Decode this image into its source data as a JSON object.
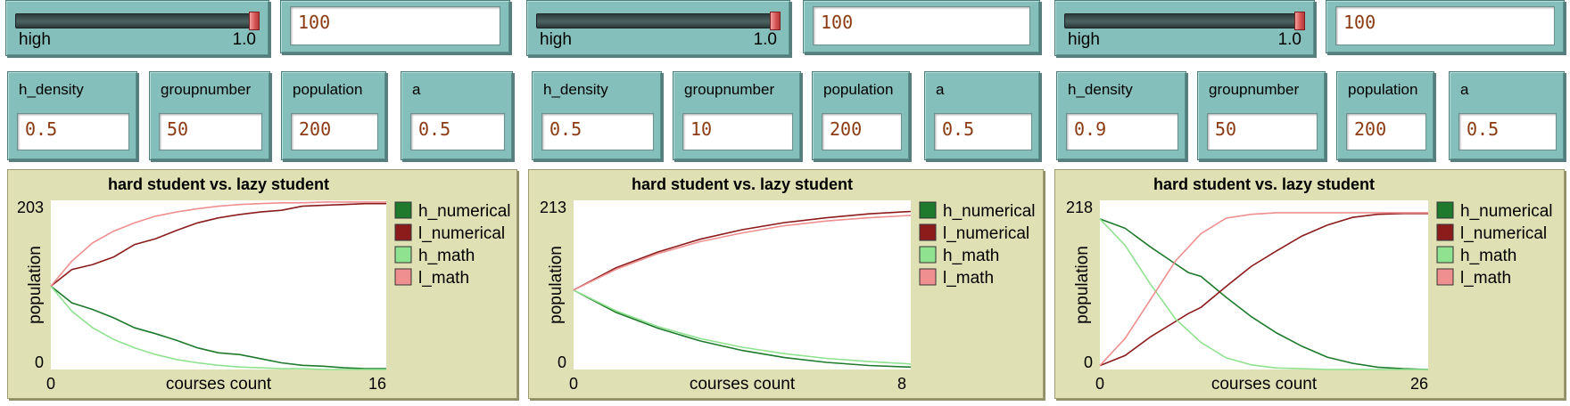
{
  "colors": {
    "h_numerical": "#1e7a2c",
    "l_numerical": "#8c1c1c",
    "h_math": "#8fe28f",
    "l_math": "#ef8f8f"
  },
  "panels": [
    {
      "slider": {
        "label": "high",
        "value": "1.0",
        "level": 1.0
      },
      "top_input": "100",
      "fields": [
        {
          "label": "h_density",
          "value": "0.5"
        },
        {
          "label": "groupnumber",
          "value": "50"
        },
        {
          "label": "population",
          "value": "200"
        },
        {
          "label": "a",
          "value": "0.5"
        }
      ],
      "chart_data": {
        "type": "line",
        "title": "hard student vs. lazy student",
        "xlabel": "courses count",
        "ylabel": "population",
        "xlim": [
          0,
          16
        ],
        "ylim": [
          0,
          203
        ],
        "x_ticks": [
          "0",
          "16"
        ],
        "y_ticks": [
          "0",
          "203"
        ],
        "legend": "right",
        "series": [
          {
            "name": "h_numerical",
            "x": [
              0,
              1,
              2,
              3,
              4,
              5,
              6,
              7,
              8,
              9,
              10,
              11,
              12,
              13,
              14,
              15,
              16
            ],
            "values": [
              100,
              80,
              72,
              62,
              50,
              43,
              35,
              26,
              20,
              18,
              13,
              8,
              5,
              4,
              2,
              1,
              1
            ]
          },
          {
            "name": "l_numerical",
            "x": [
              0,
              1,
              2,
              3,
              4,
              5,
              6,
              7,
              8,
              9,
              10,
              11,
              12,
              13,
              14,
              15,
              16
            ],
            "values": [
              100,
              120,
              126,
              135,
              150,
              157,
              167,
              176,
              182,
              186,
              189,
              191,
              196,
              197,
              198,
              199,
              199
            ]
          },
          {
            "name": "h_math",
            "x": [
              0,
              1,
              2,
              3,
              4,
              5,
              6,
              7,
              8,
              9,
              10,
              11,
              12,
              13,
              14,
              15,
              16
            ],
            "values": [
              100,
              70,
              50,
              36,
              26,
              18,
              12,
              8,
              5,
              3,
              2,
              1,
              1,
              0,
              0,
              0,
              0
            ]
          },
          {
            "name": "l_math",
            "x": [
              0,
              1,
              2,
              3,
              4,
              5,
              6,
              7,
              8,
              9,
              10,
              11,
              12,
              13,
              14,
              15,
              16
            ],
            "values": [
              100,
              130,
              152,
              166,
              176,
              184,
              189,
              193,
              196,
              198,
              199,
              200,
              200,
              201,
              201,
              201,
              201
            ]
          }
        ]
      }
    },
    {
      "slider": {
        "label": "high",
        "value": "1.0",
        "level": 1.0
      },
      "top_input": "100",
      "fields": [
        {
          "label": "h_density",
          "value": "0.5"
        },
        {
          "label": "groupnumber",
          "value": "10"
        },
        {
          "label": "population",
          "value": "200"
        },
        {
          "label": "a",
          "value": "0.5"
        }
      ],
      "chart_data": {
        "type": "line",
        "title": "hard student vs. lazy student",
        "xlabel": "courses count",
        "ylabel": "population",
        "xlim": [
          0,
          8
        ],
        "ylim": [
          0,
          213
        ],
        "x_ticks": [
          "0",
          "8"
        ],
        "y_ticks": [
          "0",
          "213"
        ],
        "legend": "right",
        "series": [
          {
            "name": "h_numerical",
            "x": [
              0,
              1,
              2,
              3,
              4,
              5,
              6,
              7,
              8
            ],
            "values": [
              100,
              72,
              52,
              36,
              24,
              15,
              9,
              5,
              3
            ]
          },
          {
            "name": "l_numerical",
            "x": [
              0,
              1,
              2,
              3,
              4,
              5,
              6,
              7,
              8
            ],
            "values": [
              100,
              128,
              148,
              164,
              176,
              185,
              191,
              196,
              199
            ]
          },
          {
            "name": "h_math",
            "x": [
              0,
              1,
              2,
              3,
              4,
              5,
              6,
              7,
              8
            ],
            "values": [
              100,
              74,
              54,
              39,
              28,
              20,
              14,
              10,
              7
            ]
          },
          {
            "name": "l_math",
            "x": [
              0,
              1,
              2,
              3,
              4,
              5,
              6,
              7,
              8
            ],
            "values": [
              100,
              126,
              146,
              161,
              172,
              181,
              187,
              191,
              194
            ]
          }
        ]
      }
    },
    {
      "slider": {
        "label": "high",
        "value": "1.0",
        "level": 1.0
      },
      "top_input": "100",
      "fields": [
        {
          "label": "h_density",
          "value": "0.9"
        },
        {
          "label": "groupnumber",
          "value": "50"
        },
        {
          "label": "population",
          "value": "200"
        },
        {
          "label": "a",
          "value": "0.5"
        }
      ],
      "chart_data": {
        "type": "line",
        "title": "hard student vs. lazy student",
        "xlabel": "courses count",
        "ylabel": "population",
        "xlim": [
          0,
          26
        ],
        "ylim": [
          0,
          218
        ],
        "x_ticks": [
          "0",
          "26"
        ],
        "y_ticks": [
          "0",
          "218"
        ],
        "legend": "right",
        "series": [
          {
            "name": "h_numerical",
            "x": [
              0,
              2,
              4,
              6,
              7,
              8,
              10,
              12,
              14,
              16,
              18,
              20,
              22,
              24,
              26
            ],
            "values": [
              194,
              182,
              158,
              136,
              125,
              120,
              93,
              68,
              47,
              30,
              16,
              8,
              3,
              1,
              0
            ]
          },
          {
            "name": "l_numerical",
            "x": [
              0,
              2,
              4,
              6,
              7,
              8,
              10,
              12,
              14,
              16,
              18,
              20,
              22,
              24,
              26
            ],
            "values": [
              5,
              18,
              42,
              62,
              72,
              80,
              107,
              133,
              153,
              172,
              186,
              196,
              200,
              201,
              201
            ]
          },
          {
            "name": "h_math",
            "x": [
              0,
              2,
              4,
              6,
              8,
              10,
              12,
              14,
              16,
              18,
              20,
              22,
              24,
              26
            ],
            "values": [
              194,
              160,
              110,
              65,
              35,
              15,
              6,
              2,
              1,
              0,
              0,
              0,
              0,
              0
            ]
          },
          {
            "name": "l_math",
            "x": [
              0,
              2,
              4,
              6,
              8,
              10,
              12,
              14,
              16,
              18,
              20,
              22,
              24,
              26
            ],
            "values": [
              5,
              40,
              90,
              140,
              175,
              195,
              200,
              202,
              202,
              202,
              202,
              202,
              202,
              202
            ]
          }
        ]
      }
    }
  ]
}
